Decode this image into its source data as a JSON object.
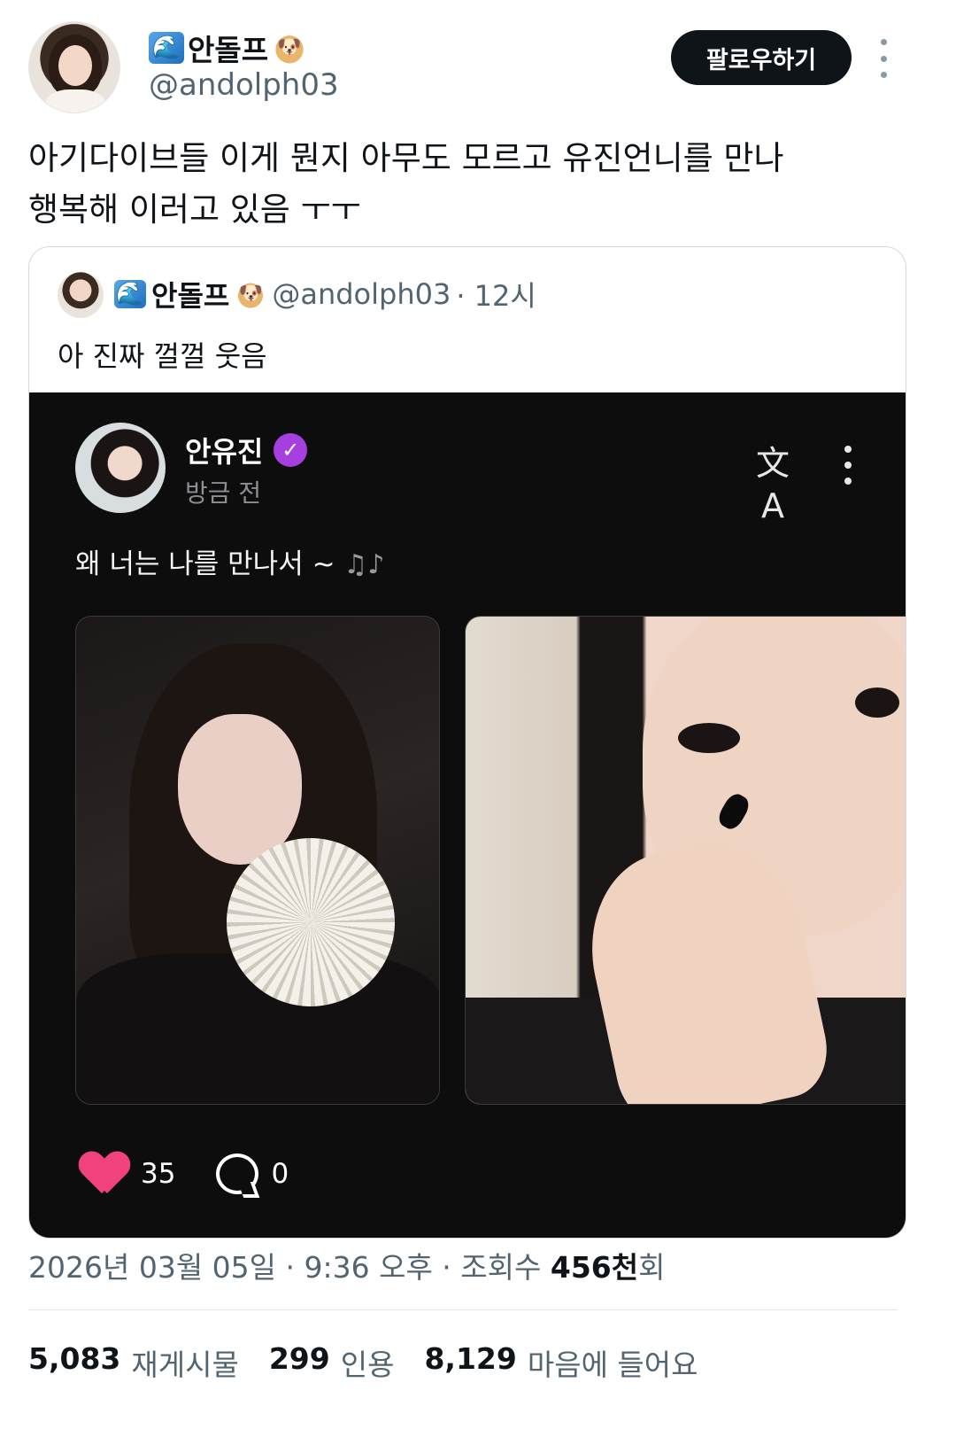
{
  "author": {
    "name": "안돌프",
    "handle": "@andolph03",
    "prefix_emoji": "🌊",
    "suffix_emoji": "🐶"
  },
  "follow_button": "팔로우하기",
  "tweet_text_line1": "아기다이브들 이게 뭔지 아무도 모르고 유진언니를 만나",
  "tweet_text_line2": "행복해 이러고 있음 ㅜㅜ",
  "quote": {
    "name": "안돌프",
    "handle": "@andolph03",
    "time": "· 12시",
    "text": "아 진짜 껄껄 웃음"
  },
  "embed": {
    "name": "안유진",
    "time": "방금 전",
    "text": "왜 너는 나를 만나서 ~",
    "music_glyph": "♫♪",
    "likes": "35",
    "comments": "0",
    "colors": {
      "heart": "#f0437e",
      "verified": "#a63fe0",
      "background": "#0e0d0e"
    }
  },
  "meta": {
    "date": "2026년 03월 05일 · 9:36 오후 · 조회수 ",
    "views": "456천",
    "views_suffix": "회"
  },
  "stats": {
    "retweets_count": "5,083",
    "retweets_label": "재게시물",
    "quotes_count": "299",
    "quotes_label": "인용",
    "likes_count": "8,129",
    "likes_label": "마음에 들어요"
  }
}
